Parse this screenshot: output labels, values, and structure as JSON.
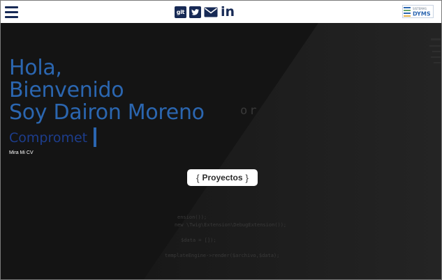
{
  "header": {
    "menu_icon": "hamburger-menu-icon",
    "social": [
      {
        "name": "git",
        "icon": "git-icon",
        "label": "git"
      },
      {
        "name": "twitter",
        "icon": "twitter-icon"
      },
      {
        "name": "email",
        "icon": "envelope-icon"
      },
      {
        "name": "linkedin",
        "icon": "linkedin-icon",
        "label": "in"
      }
    ],
    "logo": {
      "icon": "dyms-logo",
      "top_text": "SISTEMAS",
      "text": "DYMS"
    }
  },
  "hero": {
    "greeting": [
      "Hola,",
      "Bienvenido",
      "Soy Dairon Moreno"
    ],
    "typed_text": "Compromet",
    "cv_link": "Mira Mi CV",
    "projects_button": {
      "open": "{",
      "label": "Proyectos",
      "close": "}"
    },
    "background_code": {
      "fragment_top": "or",
      "lines": [
        "ension());",
        "new \\Twig\\Extension\\DebugExtension());",
        "$data = []);",
        "templateEngine->render($archivo,$data);"
      ]
    }
  },
  "colors": {
    "accent": "#2b66b0",
    "typed": "#1d3d8c",
    "navy": "#172a55",
    "hero_bg": "#151515"
  }
}
